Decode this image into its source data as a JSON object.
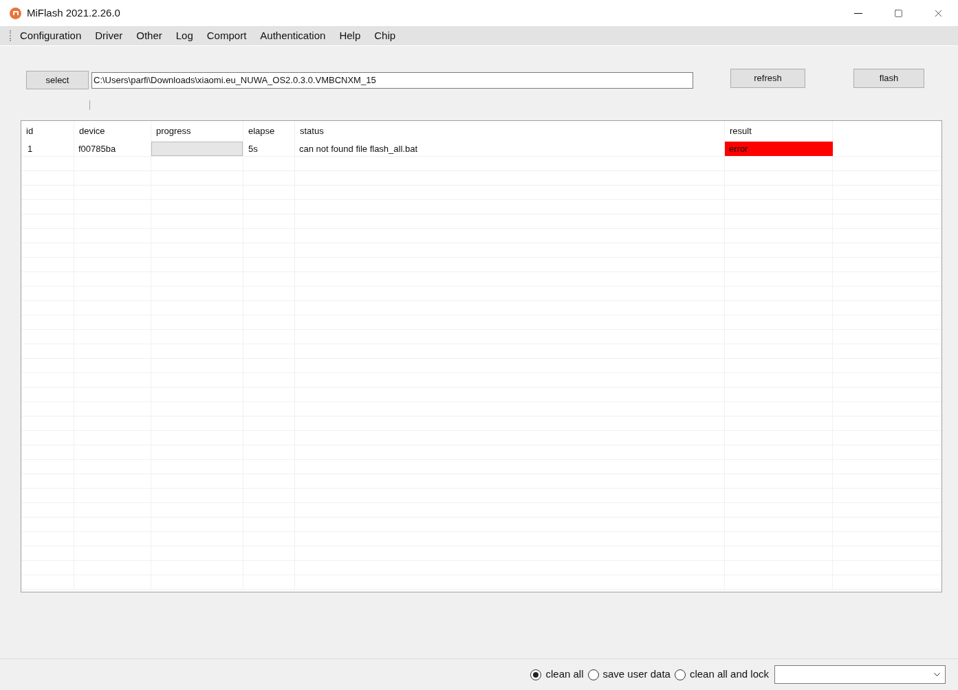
{
  "window": {
    "title": "MiFlash 2021.2.26.0"
  },
  "menu": [
    "Configuration",
    "Driver",
    "Other",
    "Log",
    "Comport",
    "Authentication",
    "Help",
    "Chip"
  ],
  "toolbar": {
    "select_button": "select",
    "path": "C:\\Users\\parfi\\Downloads\\xiaomi.eu_NUWA_OS2.0.3.0.VMBCNXM_15",
    "refresh_button": "refresh",
    "flash_button": "flash"
  },
  "table": {
    "columns": [
      "id",
      "device",
      "progress",
      "elapse",
      "status",
      "result"
    ],
    "rows": [
      {
        "id": "1",
        "device": "f00785ba",
        "level": 0,
        "elapse": "5s",
        "status": "can not found file flash_all.bat",
        "result": {
          "text": "error",
          "kind": "error"
        }
      }
    ]
  },
  "options": [
    {
      "label": "clean all",
      "selected": true
    },
    {
      "label": "save user data",
      "selected": false
    },
    {
      "label": "clean all and lock",
      "selected": false
    }
  ]
}
